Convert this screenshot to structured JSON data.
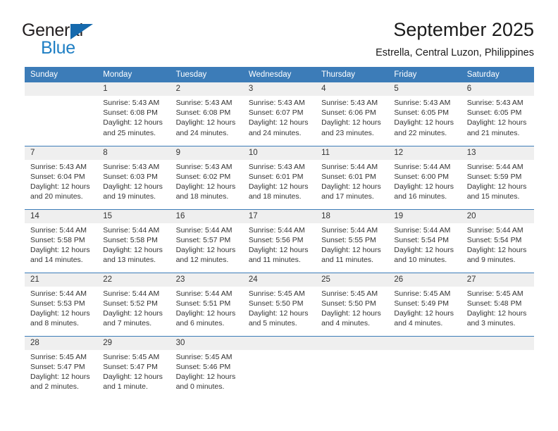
{
  "logo": {
    "line1": "General",
    "line2": "Blue",
    "triangle_icon": "triangle-icon",
    "color_dark": "#231f20",
    "color_blue": "#1f7fc4"
  },
  "header": {
    "title": "September 2025",
    "subtitle": "Estrella, Central Luzon, Philippines"
  },
  "theme": {
    "header_bg": "#3c7cb8",
    "header_text": "#ffffff",
    "daynum_bg": "#efefef",
    "body_text": "#333333"
  },
  "calendar": {
    "weekday_headers": [
      "Sunday",
      "Monday",
      "Tuesday",
      "Wednesday",
      "Thursday",
      "Friday",
      "Saturday"
    ],
    "weeks": [
      [
        {
          "day": "",
          "sunrise": "",
          "sunset": "",
          "daylight1": "",
          "daylight2": ""
        },
        {
          "day": "1",
          "sunrise": "Sunrise: 5:43 AM",
          "sunset": "Sunset: 6:08 PM",
          "daylight1": "Daylight: 12 hours",
          "daylight2": "and 25 minutes."
        },
        {
          "day": "2",
          "sunrise": "Sunrise: 5:43 AM",
          "sunset": "Sunset: 6:08 PM",
          "daylight1": "Daylight: 12 hours",
          "daylight2": "and 24 minutes."
        },
        {
          "day": "3",
          "sunrise": "Sunrise: 5:43 AM",
          "sunset": "Sunset: 6:07 PM",
          "daylight1": "Daylight: 12 hours",
          "daylight2": "and 24 minutes."
        },
        {
          "day": "4",
          "sunrise": "Sunrise: 5:43 AM",
          "sunset": "Sunset: 6:06 PM",
          "daylight1": "Daylight: 12 hours",
          "daylight2": "and 23 minutes."
        },
        {
          "day": "5",
          "sunrise": "Sunrise: 5:43 AM",
          "sunset": "Sunset: 6:05 PM",
          "daylight1": "Daylight: 12 hours",
          "daylight2": "and 22 minutes."
        },
        {
          "day": "6",
          "sunrise": "Sunrise: 5:43 AM",
          "sunset": "Sunset: 6:05 PM",
          "daylight1": "Daylight: 12 hours",
          "daylight2": "and 21 minutes."
        }
      ],
      [
        {
          "day": "7",
          "sunrise": "Sunrise: 5:43 AM",
          "sunset": "Sunset: 6:04 PM",
          "daylight1": "Daylight: 12 hours",
          "daylight2": "and 20 minutes."
        },
        {
          "day": "8",
          "sunrise": "Sunrise: 5:43 AM",
          "sunset": "Sunset: 6:03 PM",
          "daylight1": "Daylight: 12 hours",
          "daylight2": "and 19 minutes."
        },
        {
          "day": "9",
          "sunrise": "Sunrise: 5:43 AM",
          "sunset": "Sunset: 6:02 PM",
          "daylight1": "Daylight: 12 hours",
          "daylight2": "and 18 minutes."
        },
        {
          "day": "10",
          "sunrise": "Sunrise: 5:43 AM",
          "sunset": "Sunset: 6:01 PM",
          "daylight1": "Daylight: 12 hours",
          "daylight2": "and 18 minutes."
        },
        {
          "day": "11",
          "sunrise": "Sunrise: 5:44 AM",
          "sunset": "Sunset: 6:01 PM",
          "daylight1": "Daylight: 12 hours",
          "daylight2": "and 17 minutes."
        },
        {
          "day": "12",
          "sunrise": "Sunrise: 5:44 AM",
          "sunset": "Sunset: 6:00 PM",
          "daylight1": "Daylight: 12 hours",
          "daylight2": "and 16 minutes."
        },
        {
          "day": "13",
          "sunrise": "Sunrise: 5:44 AM",
          "sunset": "Sunset: 5:59 PM",
          "daylight1": "Daylight: 12 hours",
          "daylight2": "and 15 minutes."
        }
      ],
      [
        {
          "day": "14",
          "sunrise": "Sunrise: 5:44 AM",
          "sunset": "Sunset: 5:58 PM",
          "daylight1": "Daylight: 12 hours",
          "daylight2": "and 14 minutes."
        },
        {
          "day": "15",
          "sunrise": "Sunrise: 5:44 AM",
          "sunset": "Sunset: 5:58 PM",
          "daylight1": "Daylight: 12 hours",
          "daylight2": "and 13 minutes."
        },
        {
          "day": "16",
          "sunrise": "Sunrise: 5:44 AM",
          "sunset": "Sunset: 5:57 PM",
          "daylight1": "Daylight: 12 hours",
          "daylight2": "and 12 minutes."
        },
        {
          "day": "17",
          "sunrise": "Sunrise: 5:44 AM",
          "sunset": "Sunset: 5:56 PM",
          "daylight1": "Daylight: 12 hours",
          "daylight2": "and 11 minutes."
        },
        {
          "day": "18",
          "sunrise": "Sunrise: 5:44 AM",
          "sunset": "Sunset: 5:55 PM",
          "daylight1": "Daylight: 12 hours",
          "daylight2": "and 11 minutes."
        },
        {
          "day": "19",
          "sunrise": "Sunrise: 5:44 AM",
          "sunset": "Sunset: 5:54 PM",
          "daylight1": "Daylight: 12 hours",
          "daylight2": "and 10 minutes."
        },
        {
          "day": "20",
          "sunrise": "Sunrise: 5:44 AM",
          "sunset": "Sunset: 5:54 PM",
          "daylight1": "Daylight: 12 hours",
          "daylight2": "and 9 minutes."
        }
      ],
      [
        {
          "day": "21",
          "sunrise": "Sunrise: 5:44 AM",
          "sunset": "Sunset: 5:53 PM",
          "daylight1": "Daylight: 12 hours",
          "daylight2": "and 8 minutes."
        },
        {
          "day": "22",
          "sunrise": "Sunrise: 5:44 AM",
          "sunset": "Sunset: 5:52 PM",
          "daylight1": "Daylight: 12 hours",
          "daylight2": "and 7 minutes."
        },
        {
          "day": "23",
          "sunrise": "Sunrise: 5:44 AM",
          "sunset": "Sunset: 5:51 PM",
          "daylight1": "Daylight: 12 hours",
          "daylight2": "and 6 minutes."
        },
        {
          "day": "24",
          "sunrise": "Sunrise: 5:45 AM",
          "sunset": "Sunset: 5:50 PM",
          "daylight1": "Daylight: 12 hours",
          "daylight2": "and 5 minutes."
        },
        {
          "day": "25",
          "sunrise": "Sunrise: 5:45 AM",
          "sunset": "Sunset: 5:50 PM",
          "daylight1": "Daylight: 12 hours",
          "daylight2": "and 4 minutes."
        },
        {
          "day": "26",
          "sunrise": "Sunrise: 5:45 AM",
          "sunset": "Sunset: 5:49 PM",
          "daylight1": "Daylight: 12 hours",
          "daylight2": "and 4 minutes."
        },
        {
          "day": "27",
          "sunrise": "Sunrise: 5:45 AM",
          "sunset": "Sunset: 5:48 PM",
          "daylight1": "Daylight: 12 hours",
          "daylight2": "and 3 minutes."
        }
      ],
      [
        {
          "day": "28",
          "sunrise": "Sunrise: 5:45 AM",
          "sunset": "Sunset: 5:47 PM",
          "daylight1": "Daylight: 12 hours",
          "daylight2": "and 2 minutes."
        },
        {
          "day": "29",
          "sunrise": "Sunrise: 5:45 AM",
          "sunset": "Sunset: 5:47 PM",
          "daylight1": "Daylight: 12 hours",
          "daylight2": "and 1 minute."
        },
        {
          "day": "30",
          "sunrise": "Sunrise: 5:45 AM",
          "sunset": "Sunset: 5:46 PM",
          "daylight1": "Daylight: 12 hours",
          "daylight2": "and 0 minutes."
        },
        {
          "day": "",
          "sunrise": "",
          "sunset": "",
          "daylight1": "",
          "daylight2": ""
        },
        {
          "day": "",
          "sunrise": "",
          "sunset": "",
          "daylight1": "",
          "daylight2": ""
        },
        {
          "day": "",
          "sunrise": "",
          "sunset": "",
          "daylight1": "",
          "daylight2": ""
        },
        {
          "day": "",
          "sunrise": "",
          "sunset": "",
          "daylight1": "",
          "daylight2": ""
        }
      ]
    ]
  }
}
